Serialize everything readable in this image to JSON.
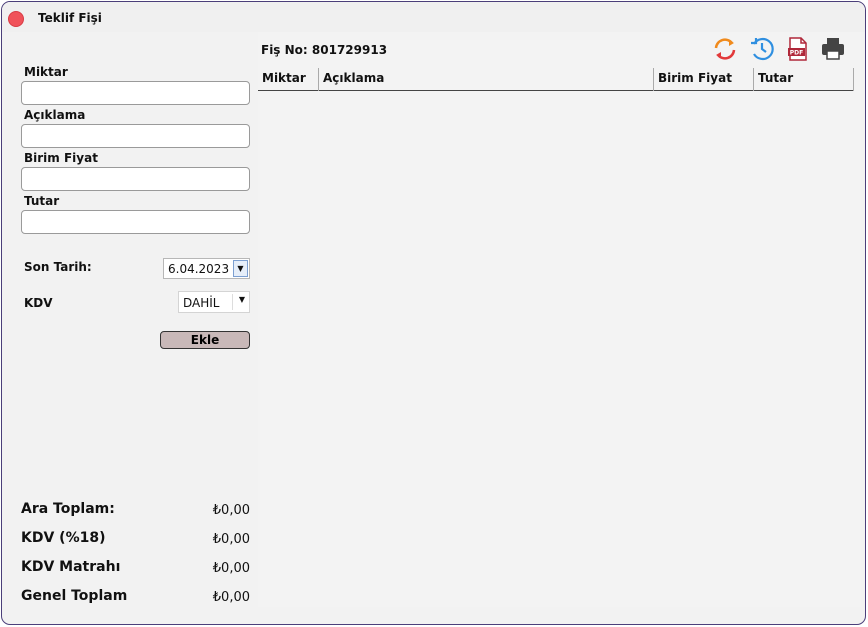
{
  "window": {
    "title": "Teklif Fişi"
  },
  "form": {
    "miktar_label": "Miktar",
    "aciklama_label": "Açıklama",
    "birim_fiyat_label": "Birim Fiyat",
    "tutar_label": "Tutar",
    "miktar_value": "",
    "aciklama_value": "",
    "birim_fiyat_value": "",
    "tutar_value": "",
    "son_tarih_label": "Son Tarih:",
    "son_tarih_value": "6.04.2023",
    "kdv_label": "KDV",
    "kdv_value": "DAHİL",
    "ekle_label": "Ekle"
  },
  "totals": [
    {
      "label": "Ara Toplam:",
      "value": "₺0,00"
    },
    {
      "label": "KDV (%18)",
      "value": "₺0,00"
    },
    {
      "label": "KDV Matrahı",
      "value": "₺0,00"
    },
    {
      "label": "Genel Toplam",
      "value": "₺0,00"
    }
  ],
  "receipt": {
    "fis_no_text": "Fiş No: 801729913"
  },
  "toolbar": {
    "icons": [
      "refresh-icon",
      "history-icon",
      "pdf-icon",
      "printer-icon"
    ],
    "pdf_text": "PDF"
  },
  "grid": {
    "columns": [
      "Miktar",
      "Açıklama",
      "Birim Fiyat",
      "Tutar"
    ],
    "rows": []
  },
  "colors": {
    "close": "#f0525a",
    "refresh_orange": "#f08a1c",
    "refresh_red": "#e2393a",
    "history_blue": "#2f8fe0",
    "pdf_red": "#b0283a",
    "printer_gray": "#444444",
    "ekle_button": "#c8b8b8"
  }
}
